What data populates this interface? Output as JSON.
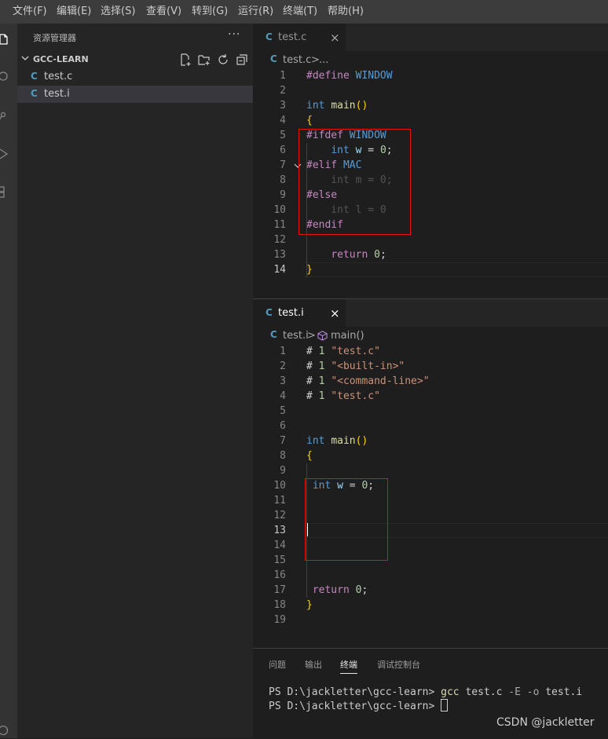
{
  "menubar": [
    "文件(F)",
    "编辑(E)",
    "选择(S)",
    "查看(V)",
    "转到(G)",
    "运行(R)",
    "终端(T)",
    "帮助(H)"
  ],
  "activity_icons": [
    "files-icon",
    "search-icon",
    "source-control-icon",
    "run-debug-icon",
    "extensions-icon",
    "account-icon"
  ],
  "explorer": {
    "title": "资源管理器",
    "more": "···",
    "section": "GCC-LEARN",
    "files": [
      {
        "badge": "C",
        "name": "test.c"
      },
      {
        "badge": "C",
        "name": "test.i"
      }
    ]
  },
  "editor_top": {
    "tab": {
      "badge": "C",
      "label": "test.c",
      "close": "×"
    },
    "breadcrumb": {
      "file": "test.c",
      "sep": ">",
      "rest": "..."
    },
    "lines": [
      {
        "n": "1",
        "t": [
          [
            "#define ",
            "#c586c0"
          ],
          [
            "WINDOW",
            "#569cd6"
          ]
        ]
      },
      {
        "n": "2",
        "t": []
      },
      {
        "n": "3",
        "t": [
          [
            "int ",
            "#569cd6"
          ],
          [
            "main",
            "#dcdcaa"
          ],
          [
            "()",
            "#ffd700"
          ]
        ]
      },
      {
        "n": "4",
        "t": [
          [
            "{",
            "#ffd700"
          ]
        ]
      },
      {
        "n": "5",
        "t": [
          [
            "#ifdef ",
            "#c586c0"
          ],
          [
            "WINDOW",
            "#569cd6"
          ]
        ]
      },
      {
        "n": "6",
        "t": [
          [
            "    ",
            ""
          ],
          [
            "int ",
            "#569cd6"
          ],
          [
            "w",
            "#9cdcfe"
          ],
          [
            " = ",
            "#d4d4d4"
          ],
          [
            "0",
            "#b5cea8"
          ],
          [
            ";",
            "#d4d4d4"
          ]
        ]
      },
      {
        "n": "7",
        "t": [
          [
            "#elif ",
            "#c586c0"
          ],
          [
            "MAC",
            "#569cd6"
          ]
        ]
      },
      {
        "n": "8",
        "t": [
          [
            "    int m = 0;",
            "#808080"
          ]
        ],
        "inactive": true
      },
      {
        "n": "9",
        "t": [
          [
            "#else",
            "#c586c0"
          ]
        ]
      },
      {
        "n": "10",
        "t": [
          [
            "    int l = 0",
            "#808080"
          ]
        ],
        "inactive": true
      },
      {
        "n": "11",
        "t": [
          [
            "#endif",
            "#c586c0"
          ]
        ]
      },
      {
        "n": "12",
        "t": []
      },
      {
        "n": "13",
        "t": [
          [
            "    ",
            ""
          ],
          [
            "return ",
            "#c586c0"
          ],
          [
            "0",
            "#b5cea8"
          ],
          [
            ";",
            "#d4d4d4"
          ]
        ]
      },
      {
        "n": "14",
        "t": [
          [
            "}",
            "#ffd700"
          ]
        ],
        "current": true
      }
    ]
  },
  "editor_bottom": {
    "tab": {
      "badge": "C",
      "label": "test.i",
      "close": "×"
    },
    "breadcrumb": {
      "file": "test.i",
      "sep": ">",
      "rest": "main()"
    },
    "lines": [
      {
        "n": "1",
        "t": [
          [
            "# ",
            "#d4d4d4"
          ],
          [
            "1 ",
            "#b5cea8"
          ],
          [
            "\"test.c\"",
            "#ce9178"
          ]
        ]
      },
      {
        "n": "2",
        "t": [
          [
            "# ",
            "#d4d4d4"
          ],
          [
            "1 ",
            "#b5cea8"
          ],
          [
            "\"<built-in>\"",
            "#ce9178"
          ]
        ]
      },
      {
        "n": "3",
        "t": [
          [
            "# ",
            "#d4d4d4"
          ],
          [
            "1 ",
            "#b5cea8"
          ],
          [
            "\"<command-line>\"",
            "#ce9178"
          ]
        ]
      },
      {
        "n": "4",
        "t": [
          [
            "# ",
            "#d4d4d4"
          ],
          [
            "1 ",
            "#b5cea8"
          ],
          [
            "\"test.c\"",
            "#ce9178"
          ]
        ]
      },
      {
        "n": "5",
        "t": []
      },
      {
        "n": "6",
        "t": []
      },
      {
        "n": "7",
        "t": [
          [
            "int ",
            "#569cd6"
          ],
          [
            "main",
            "#dcdcaa"
          ],
          [
            "()",
            "#ffd700"
          ]
        ]
      },
      {
        "n": "8",
        "t": [
          [
            "{",
            "#ffd700"
          ]
        ]
      },
      {
        "n": "9",
        "t": []
      },
      {
        "n": "10",
        "t": [
          [
            " ",
            ""
          ],
          [
            "int ",
            "#569cd6"
          ],
          [
            "w",
            "#9cdcfe"
          ],
          [
            " = ",
            "#d4d4d4"
          ],
          [
            "0",
            "#b5cea8"
          ],
          [
            ";",
            "#d4d4d4"
          ]
        ]
      },
      {
        "n": "11",
        "t": []
      },
      {
        "n": "12",
        "t": []
      },
      {
        "n": "13",
        "t": [],
        "current": true
      },
      {
        "n": "14",
        "t": []
      },
      {
        "n": "15",
        "t": []
      },
      {
        "n": "16",
        "t": []
      },
      {
        "n": "17",
        "t": [
          [
            " ",
            ""
          ],
          [
            "return ",
            "#c586c0"
          ],
          [
            "0",
            "#b5cea8"
          ],
          [
            ";",
            "#d4d4d4"
          ]
        ]
      },
      {
        "n": "18",
        "t": [
          [
            "}",
            "#ffd700"
          ]
        ]
      },
      {
        "n": "19",
        "t": []
      }
    ]
  },
  "panel": {
    "tabs": [
      "问题",
      "输出",
      "终端",
      "调试控制台"
    ],
    "active_tab": "终端",
    "terminal": {
      "line1": {
        "prompt": "PS D:\\jackletter\\gcc-learn> ",
        "cmd": "gcc",
        "args": " test.c ",
        "flags": "-E -o",
        "tail": " test.i"
      },
      "line2": {
        "prompt": "PS D:\\jackletter\\gcc-learn> "
      }
    }
  },
  "watermark": "CSDN @jackletter",
  "colors": {
    "accent": "#519aba",
    "highlight_box": "#e51400",
    "cmd": "#dcdcaa"
  }
}
